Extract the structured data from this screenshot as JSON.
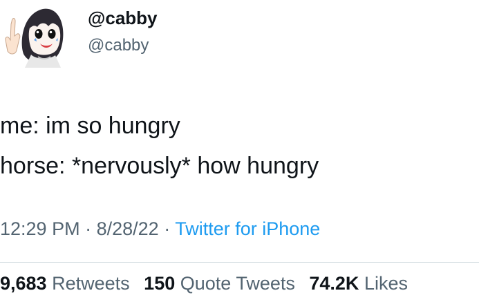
{
  "tweet": {
    "author": {
      "display_name": "@cabby",
      "handle": "@cabby",
      "avatar_icon": "cartoon-girl-avatar"
    },
    "text_lines": [
      "me: im so hungry",
      "horse: *nervously* how hungry"
    ],
    "meta": {
      "time": "12:29 PM",
      "separator_1": "·",
      "date": "8/28/22",
      "separator_2": "·",
      "source": "Twitter for iPhone"
    },
    "stats": {
      "retweets_count": "9,683",
      "retweets_label": "Retweets",
      "quote_tweets_count": "150",
      "quote_tweets_label": "Quote Tweets",
      "likes_count": "74.2K",
      "likes_label": "Likes"
    }
  },
  "colors": {
    "text_primary": "#0f1419",
    "text_secondary": "#536471",
    "link": "#1d9bf0",
    "divider": "#cfd9de"
  }
}
